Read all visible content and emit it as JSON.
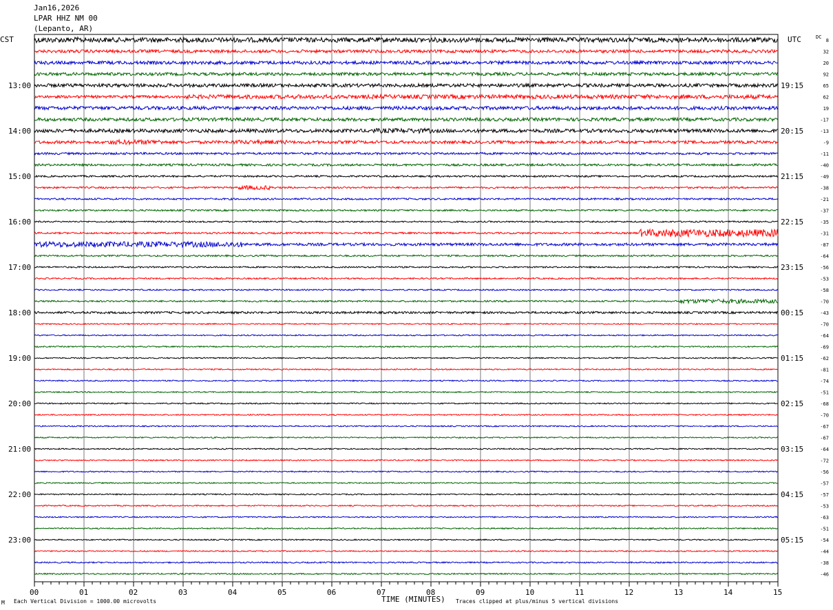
{
  "header": {
    "date": "Jan16,2026",
    "station": "LPAR HHZ NM 00",
    "location": "(Lepanto, AR)"
  },
  "left_tz": "CST",
  "right_tz": "UTC",
  "dc_label": "DC",
  "footer": {
    "vertical_division": "Each Vertical Division = 1000.00 microvolts",
    "clip_note": "Traces clipped at plus/minus 5 vertical divisions",
    "corner_mark": "M"
  },
  "chart_data": {
    "type": "line",
    "xlabel": "TIME (MINUTES)",
    "xlim": [
      0,
      15
    ],
    "x_ticks": [
      "00",
      "01",
      "02",
      "03",
      "04",
      "05",
      "06",
      "07",
      "08",
      "09",
      "10",
      "11",
      "12",
      "13",
      "14",
      "15"
    ],
    "trace_colors": [
      "#000000",
      "#ff0000",
      "#0000cc",
      "#006400"
    ],
    "hour_labels_left": [
      "13:00",
      "14:00",
      "15:00",
      "16:00",
      "17:00",
      "18:00",
      "19:00",
      "20:00",
      "21:00",
      "22:00",
      "23:00"
    ],
    "hour_labels_right": [
      "19:15",
      "20:15",
      "21:15",
      "22:15",
      "23:15",
      "00:15",
      "01:15",
      "02:15",
      "03:15",
      "04:15",
      "05:15"
    ],
    "dc_offsets": [
      "8",
      "32",
      "20",
      "92",
      "65",
      "62",
      "19",
      "-17",
      "-13",
      "-9",
      "-11",
      "-40",
      "-49",
      "-38",
      "-21",
      "-37",
      "-35",
      "-31",
      "-87",
      "-64",
      "-56",
      "-53",
      "-58",
      "-70",
      "-43",
      "-70",
      "-64",
      "-69",
      "-62",
      "-81",
      "-74",
      "-51",
      "-68",
      "-70",
      "-67",
      "-67",
      "-64",
      "-72",
      "-56",
      "-57",
      "-57",
      "-53",
      "-63",
      "-51",
      "-54",
      "-44",
      "-38",
      "-46"
    ],
    "trace_amplitudes": [
      3.5,
      2.2,
      2.4,
      2.2,
      2.5,
      2.0,
      2.6,
      2.4,
      2.6,
      2.2,
      1.6,
      1.6,
      1.3,
      1.3,
      1.3,
      1.2,
      1.1,
      1.3,
      2.0,
      1.2,
      1.1,
      1.1,
      1.0,
      1.2,
      1.6,
      0.9,
      0.9,
      0.9,
      0.9,
      0.9,
      0.9,
      0.9,
      0.9,
      0.9,
      0.9,
      0.9,
      0.9,
      0.9,
      0.9,
      0.9,
      0.9,
      0.9,
      0.9,
      0.9,
      0.9,
      0.9,
      1.0,
      1.0
    ],
    "events": [
      {
        "trace": 9,
        "x_start": 1.5,
        "x_end": 2.6,
        "amp": 3.5
      },
      {
        "trace": 9,
        "x_start": 4.0,
        "x_end": 5.1,
        "amp": 3.0
      },
      {
        "trace": 8,
        "x_start": 6.8,
        "x_end": 8.0,
        "amp": 3.5
      },
      {
        "trace": 13,
        "x_start": 4.1,
        "x_end": 4.8,
        "amp": 3.0
      },
      {
        "trace": 17,
        "x_start": 12.2,
        "x_end": 15.0,
        "amp": 5.5
      },
      {
        "trace": 18,
        "x_start": 0.0,
        "x_end": 4.2,
        "amp": 4.0
      },
      {
        "trace": 23,
        "x_start": 13.0,
        "x_end": 15.0,
        "amp": 3.0
      },
      {
        "trace": 0,
        "x_start": 0.0,
        "x_end": 1.0,
        "amp": 4.0
      },
      {
        "trace": 5,
        "x_start": 3.0,
        "x_end": 15.0,
        "amp": 3.0
      }
    ]
  }
}
